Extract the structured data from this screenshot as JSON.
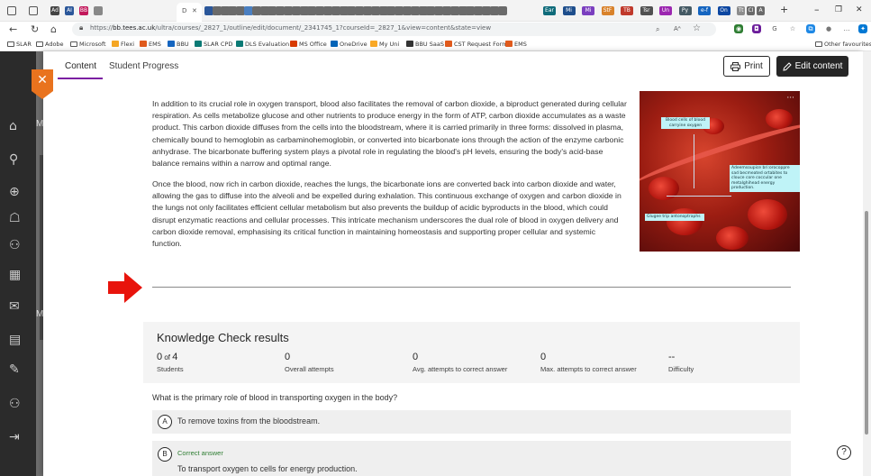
{
  "browser": {
    "tabs": [
      {
        "icon": "window-icon",
        "label": "",
        "color": "#f3f3f3"
      },
      {
        "icon": "tab-actions-icon",
        "label": "",
        "color": "#f3f3f3"
      },
      {
        "icon": "adobe-icon",
        "label": "Ad",
        "color": "#444444"
      },
      {
        "icon": "ai-icon",
        "label": "AI",
        "color": "#2b579a"
      },
      {
        "icon": "bb-icon",
        "label": "BB",
        "color": "#c2185b"
      },
      {
        "icon": "sync-icon",
        "label": "",
        "color": "#888888"
      },
      {
        "icon": "page-icon",
        "label": "",
        "color": "#2b579a"
      },
      {
        "icon": "page-icon",
        "label": "",
        "color": "#6a6a6a"
      },
      {
        "icon": "page-icon",
        "label": "",
        "color": "#6a6a6a"
      },
      {
        "icon": "page-icon",
        "label": "",
        "color": "#6a6a6a"
      },
      {
        "icon": "page-icon",
        "label": "",
        "color": "#6a6a6a"
      },
      {
        "icon": "page-icon",
        "label": "",
        "color": "#4a7fc1"
      },
      {
        "icon": "page-icon",
        "label": "",
        "color": "#6a6a6a"
      },
      {
        "icon": "page-icon",
        "label": "",
        "color": "#6a6a6a"
      },
      {
        "icon": "page-icon",
        "label": "",
        "color": "#6a6a6a"
      },
      {
        "icon": "page-icon",
        "label": "",
        "color": "#6a6a6a"
      },
      {
        "icon": "page-icon",
        "label": "",
        "color": "#6a6a6a"
      },
      {
        "icon": "page-icon",
        "label": "",
        "color": "#6a6a6a"
      },
      {
        "icon": "page-icon",
        "label": "",
        "color": "#6a6a6a"
      },
      {
        "icon": "page-icon",
        "label": "",
        "color": "#6a6a6a"
      },
      {
        "icon": "page-icon",
        "label": "",
        "color": "#6a6a6a"
      },
      {
        "icon": "page-icon",
        "label": "",
        "color": "#6a6a6a"
      },
      {
        "icon": "page-icon",
        "label": "",
        "color": "#6a6a6a"
      },
      {
        "icon": "page-icon",
        "label": "",
        "color": "#6a6a6a"
      },
      {
        "icon": "page-icon",
        "label": "",
        "color": "#6a6a6a"
      },
      {
        "icon": "page-icon",
        "label": "",
        "color": "#6a6a6a"
      },
      {
        "icon": "page-icon",
        "label": "",
        "color": "#6a6a6a"
      },
      {
        "icon": "page-icon",
        "label": "",
        "color": "#6a6a6a"
      },
      {
        "icon": "page-icon",
        "label": "",
        "color": "#6a6a6a"
      },
      {
        "icon": "page-icon",
        "label": "",
        "color": "#6a6a6a"
      },
      {
        "icon": "page-icon",
        "label": "",
        "color": "#6a6a6a"
      },
      {
        "icon": "page-icon",
        "label": "",
        "color": "#6a6a6a"
      },
      {
        "icon": "page-icon",
        "label": "",
        "color": "#6a6a6a"
      },
      {
        "icon": "page-icon",
        "label": "",
        "color": "#6a6a6a"
      },
      {
        "icon": "page-icon",
        "label": "",
        "color": "#6a6a6a"
      },
      {
        "icon": "page-icon",
        "label": "",
        "color": "#6a6a6a"
      },
      {
        "icon": "page-icon",
        "label": "",
        "color": "#6a6a6a"
      },
      {
        "icon": "page-icon",
        "label": "",
        "color": "#6a6a6a"
      },
      {
        "icon": "page-icon",
        "label": "",
        "color": "#6a6a6a"
      },
      {
        "icon": "page-icon",
        "label": "",
        "color": "#6a6a6a"
      },
      {
        "icon": "page-icon",
        "label": "",
        "color": "#6a6a6a"
      },
      {
        "icon": "page-icon",
        "label": "",
        "color": "#6a6a6a"
      },
      {
        "icon": "page-icon",
        "label": "",
        "color": "#6a6a6a"
      },
      {
        "icon": "page-icon",
        "label": "",
        "color": "#6a6a6a"
      }
    ],
    "colored_tabs": [
      {
        "label": "Ear",
        "color": "#0f6b7a"
      },
      {
        "label": "Mi",
        "color": "#1e4e8c"
      },
      {
        "label": "Mi",
        "color": "#7b3fbf"
      },
      {
        "label": "StF",
        "color": "#d9822b"
      },
      {
        "label": "TB",
        "color": "#c0392b"
      },
      {
        "label": "Tsr",
        "color": "#505050"
      },
      {
        "label": "Un",
        "color": "#9c27b0"
      },
      {
        "label": "Py",
        "color": "#455a64"
      },
      {
        "label": "e-f",
        "color": "#1565c0"
      },
      {
        "label": "On",
        "color": "#0d47a1"
      },
      {
        "label": "Tt",
        "color": "#8d8d8d"
      },
      {
        "label": "CI",
        "color": "#6a6a6a"
      },
      {
        "label": "A",
        "color": "#6a6a6a"
      }
    ],
    "active_tab": {
      "label": "D",
      "close": "✕"
    },
    "new_tab": "+",
    "window_controls": {
      "minimize": "–",
      "maximize": "❐",
      "close": "✕"
    },
    "nav": {
      "back": "←",
      "forward": "→",
      "refresh": "↻",
      "home": "⌂"
    },
    "url": {
      "prefix": "https://",
      "host": "bb.tees.ac.uk",
      "path": "/ultra/courses/_2827_1/outline/edit/document/_2341745_1?courseId=_2827_1&view=content&state=view"
    },
    "address_actions": [
      "⌕",
      "Aᴬ",
      "☆"
    ],
    "extensions": [
      {
        "icon": "extension-icon",
        "glyph": "◉",
        "color": "#2e7d32"
      },
      {
        "icon": "extension-icon",
        "glyph": "◘",
        "color": "#6a1b9a"
      },
      {
        "icon": "refresh-ext-icon",
        "glyph": "G",
        "color": "#555555"
      },
      {
        "icon": "favorites-icon",
        "glyph": "☆",
        "color": "#555555"
      },
      {
        "icon": "collections-icon",
        "glyph": "⧉",
        "color": "#1e88e5"
      },
      {
        "icon": "profile-icon",
        "glyph": "●",
        "color": "#777777"
      },
      {
        "icon": "more-icon",
        "glyph": "…",
        "color": "#555555"
      },
      {
        "icon": "copilot-icon",
        "glyph": "✦",
        "color": "#0078d4"
      }
    ],
    "bookmarks": [
      {
        "label": "SLAR",
        "icon": "folder-icon",
        "color": ""
      },
      {
        "label": "Adobe",
        "icon": "folder-icon",
        "color": ""
      },
      {
        "label": "Microsoft",
        "icon": "folder-icon",
        "color": ""
      },
      {
        "label": "Flexi",
        "icon": "flexi-icon",
        "color": "#f5a623"
      },
      {
        "label": "EMS",
        "icon": "ems-icon",
        "color": "#e05a1c"
      },
      {
        "label": "BBU",
        "icon": "bbu-icon",
        "color": "#1565c0"
      },
      {
        "label": "SLAR CPD",
        "icon": "slar-icon",
        "color": "#0b7a75"
      },
      {
        "label": "DLS Evaluation",
        "icon": "dls-icon",
        "color": "#0b7a75"
      },
      {
        "label": "MS Office",
        "icon": "office-icon",
        "color": "#d83b01"
      },
      {
        "label": "OneDrive",
        "icon": "onedrive-icon",
        "color": "#0364b8"
      },
      {
        "label": "My Uni",
        "icon": "uni-icon",
        "color": "#f9a825"
      },
      {
        "label": "BBU SaaS",
        "icon": "bbu-icon",
        "color": "#333333"
      },
      {
        "label": "CST Request Form",
        "icon": "cst-icon",
        "color": "#e05a1c"
      },
      {
        "label": "EMS",
        "icon": "ems-icon",
        "color": "#e05a1c"
      }
    ],
    "other_favourites": "Other favourites"
  },
  "background_app": {
    "sidebar_glyphs": [
      "⌂",
      "⚲",
      "⊕",
      "☖",
      "⚇",
      "▦",
      "✉",
      "▤",
      "✎",
      "⚇",
      "⇥"
    ],
    "letters": [
      "M",
      "M"
    ]
  },
  "panel": {
    "close_label": "✕",
    "tabs": {
      "content": "Content",
      "progress": "Student Progress"
    },
    "print_label": "Print",
    "edit_label": "Edit content",
    "paragraph_1": "In addition to its crucial role in oxygen transport, blood also facilitates the removal of carbon dioxide, a biproduct generated during cellular respiration. As cells metabolize glucose and other nutrients to produce energy in the form of ATP, carbon dioxide accumulates as a waste product. This carbon dioxide diffuses from the cells into the bloodstream, where it is carried primarily in three forms: dissolved in plasma, chemically bound to hemoglobin as carbaminohemoglobin, or converted into bicarbonate ions through the action of the enzyme carbonic anhydrase. The bicarbonate buffering system plays a pivotal role in regulating the blood's pH levels, ensuring the body's acid-base balance remains within a narrow and optimal range.",
    "paragraph_2": "Once the blood, now rich in carbon dioxide, reaches the lungs, the bicarbonate ions are converted back into carbon dioxide and water, allowing the gas to diffuse into the alveoli and be expelled during exhalation. This continuous exchange of oxygen and carbon dioxide in the lungs not only facilitates efficient cellular metabolism but also prevents the buildup of acidic byproducts in the blood, which could disrupt enzymatic reactions and cellular processes. This intricate mechanism underscores the dual role of blood in oxygen delivery and carbon dioxide removal, emphasising its critical function in maintaining homeostasis and supporting proper cellular and systemic function.",
    "figure": {
      "menu": "···",
      "label_1": "Blood cells of blood carryine oxygen",
      "label_2": "Adeemsoupice bri:orocoppre sad becmeated ortabites to clouce core coccular one metalghihead energy production.",
      "label_3": "Glugee trip antonoptraphs"
    },
    "arrow_color": "#e8140c",
    "knowledge_check": {
      "title": "Knowledge Check results",
      "stats": [
        {
          "value": "0",
          "suffix": " of ",
          "total": "4",
          "label": "Students"
        },
        {
          "value": "0",
          "suffix": "",
          "total": "",
          "label": "Overall attempts"
        },
        {
          "value": "0",
          "suffix": "",
          "total": "",
          "label": "Avg. attempts to correct answer"
        },
        {
          "value": "0",
          "suffix": "",
          "total": "",
          "label": "Max. attempts to correct answer"
        },
        {
          "value": "--",
          "suffix": "",
          "total": "",
          "label": "Difficulty"
        }
      ]
    },
    "question": "What is the primary role of blood in transporting oxygen in the body?",
    "answers": [
      {
        "letter": "A",
        "text": "To remove toxins from the bloodstream.",
        "correct_label": ""
      },
      {
        "letter": "B",
        "text": "To transport oxygen to cells for energy production.",
        "correct_label": "Correct answer"
      }
    ],
    "help": "?"
  }
}
